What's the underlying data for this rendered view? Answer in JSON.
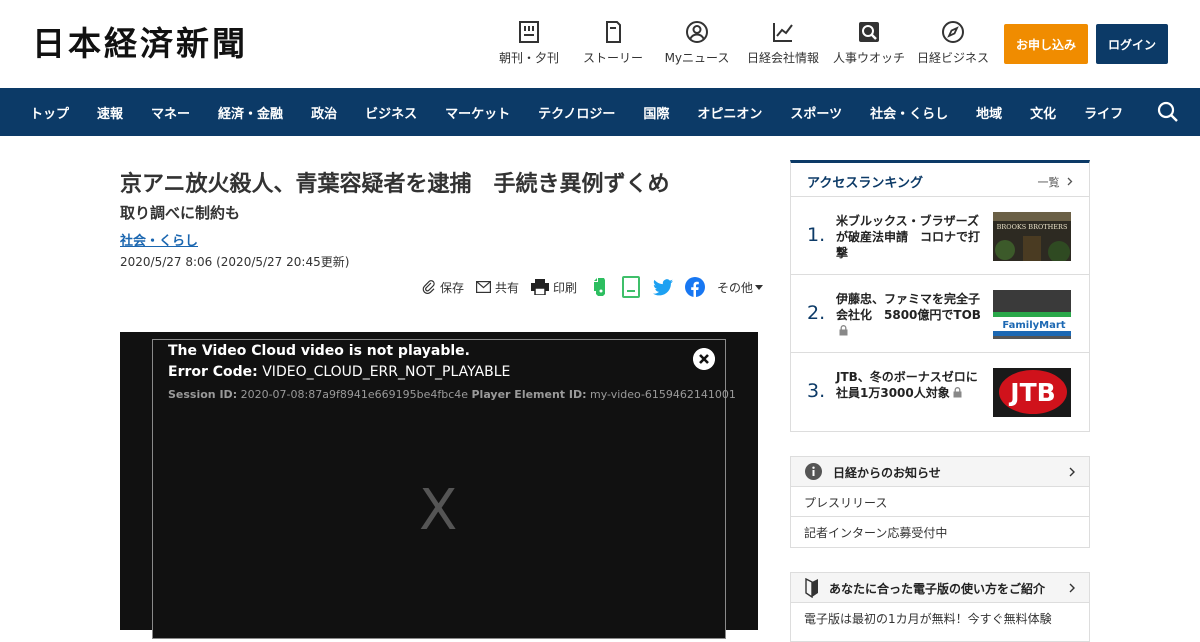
{
  "logo": "日本経済新聞",
  "header_nav": [
    {
      "label": "朝刊・夕刊",
      "icon": "newspaper-icon"
    },
    {
      "label": "ストーリー",
      "icon": "book-icon"
    },
    {
      "label": "Myニュース",
      "icon": "user-icon"
    },
    {
      "label": "日経会社情報",
      "icon": "chart-icon"
    },
    {
      "label": "人事ウオッチ",
      "icon": "search-person-icon"
    },
    {
      "label": "日経ビジネス",
      "icon": "compass-icon"
    }
  ],
  "buttons": {
    "apply": "お申し込み",
    "login": "ログイン"
  },
  "colors": {
    "brand": "#0c3a67",
    "apply": "#f08c00",
    "link": "#1a66b0"
  },
  "global_nav": [
    "トップ",
    "速報",
    "マネー",
    "経済・金融",
    "政治",
    "ビジネス",
    "マーケット",
    "テクノロジー",
    "国際",
    "オピニオン",
    "スポーツ",
    "社会・くらし",
    "地域",
    "文化",
    "ライフ"
  ],
  "article": {
    "headline": "京アニ放火殺人、青葉容疑者を逮捕　手続き異例ずくめ",
    "subhead": "取り調べに制約も",
    "category": "社会・くらし",
    "date": "2020/5/27 8:06 (2020/5/27 20:45更新)"
  },
  "tools": {
    "save": "保存",
    "share": "共有",
    "print": "印刷",
    "more": "その他"
  },
  "video": {
    "error_title": "The Video Cloud video is not playable.",
    "error_code_label": "Error Code:",
    "error_code": " VIDEO_CLOUD_ERR_NOT_PLAYABLE",
    "session_label": "Session ID:",
    "session_id": " 2020-07-08:87a9f8941e669195be4fbc4e ",
    "player_label": "Player Element ID:",
    "player_id": " my-video-6159462141001",
    "placeholder": "X"
  },
  "ranking": {
    "title": "アクセスランキング",
    "more": "一覧",
    "items": [
      {
        "num": "1.",
        "text": "米ブルックス・ブラザーズが破産法申請　コロナで打撃",
        "image_label": "BROOKS BROTHERS",
        "locked": false
      },
      {
        "num": "2.",
        "text": "伊藤忠、ファミマを完全子会社化　5800億円でTOB",
        "image_label": "FamilyMart",
        "locked": true
      },
      {
        "num": "3.",
        "text": "JTB、冬のボーナスゼロに　社員1万3000人対象",
        "image_label": "JTB",
        "locked": true
      }
    ]
  },
  "notices": {
    "title": "日経からのお知らせ",
    "rows": [
      "プレスリリース",
      "記者インターン応募受付中"
    ]
  },
  "guide": {
    "title": "あなたに合った電子版の使い方をご紹介",
    "row": "電子版は最初の1カ月が無料！今すぐ無料体験"
  }
}
